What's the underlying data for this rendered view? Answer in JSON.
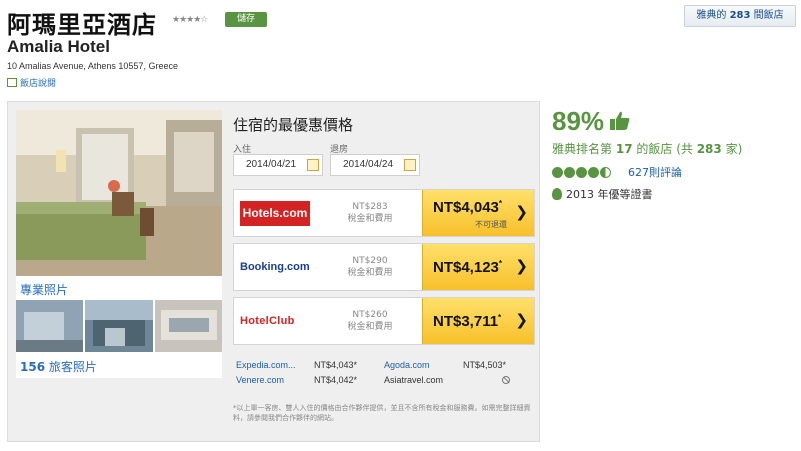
{
  "header": {
    "title": "阿瑪里亞酒店",
    "star_glyphs": "★★★★☆",
    "save_label": "儲存",
    "english_name": "Amalia Hotel",
    "address": "10 Amalias Avenue, Athens 10557, Greece",
    "write_review": "飯店說閱",
    "hotels_link_prefix": "雅典的",
    "hotels_link_count": "283",
    "hotels_link_suffix": "間飯店"
  },
  "photos": {
    "pro_label": "專業照片",
    "guest_count": "156",
    "guest_label": "旅客照片"
  },
  "booking": {
    "title": "住宿的最優惠價格",
    "checkin_label": "入住",
    "checkout_label": "退房",
    "checkin_value": "2014/04/21",
    "checkout_value": "2014/04/24",
    "offers": [
      {
        "provider": "Hotels.com",
        "tax_amount": "NT$283",
        "tax_note": "稅金和費用",
        "price": "NT$4,043",
        "note": "不可退還"
      },
      {
        "provider": "Booking.com",
        "tax_amount": "NT$290",
        "tax_note": "稅金和費用",
        "price": "NT$4,123",
        "note": ""
      },
      {
        "provider": "HotelClub",
        "tax_amount": "NT$260",
        "tax_note": "稅金和費用",
        "price": "NT$3,711",
        "note": ""
      }
    ],
    "other_offers": [
      {
        "name": "Expedia.com...",
        "price": "NT$4,043*"
      },
      {
        "name": "Agoda.com",
        "price": "NT$4,503*"
      },
      {
        "name": "Venere.com",
        "price": "NT$4,042*"
      },
      {
        "name": "Asiatravel.com",
        "price": ""
      }
    ],
    "disclaimer": "*以上單一客房、雙人入住的價格由合作夥伴提供，並且不含所有稅金和服務費。如需完整詳細資料，請參閱我們合作夥伴的網站。"
  },
  "rating": {
    "score": "89%",
    "rank_prefix": "雅典排名第",
    "rank_number": "17",
    "rank_middle": "的飯店 (共",
    "rank_total": "283",
    "rank_suffix": "家)",
    "bubble_rating": 4.5,
    "reviews": "627則評論",
    "award": "2013 年優等證書"
  },
  "colors": {
    "accent_green": "#589442",
    "link_blue": "#1d5fa8",
    "cta_yellow": "#f7c02b",
    "hotels_red": "#d32323"
  }
}
